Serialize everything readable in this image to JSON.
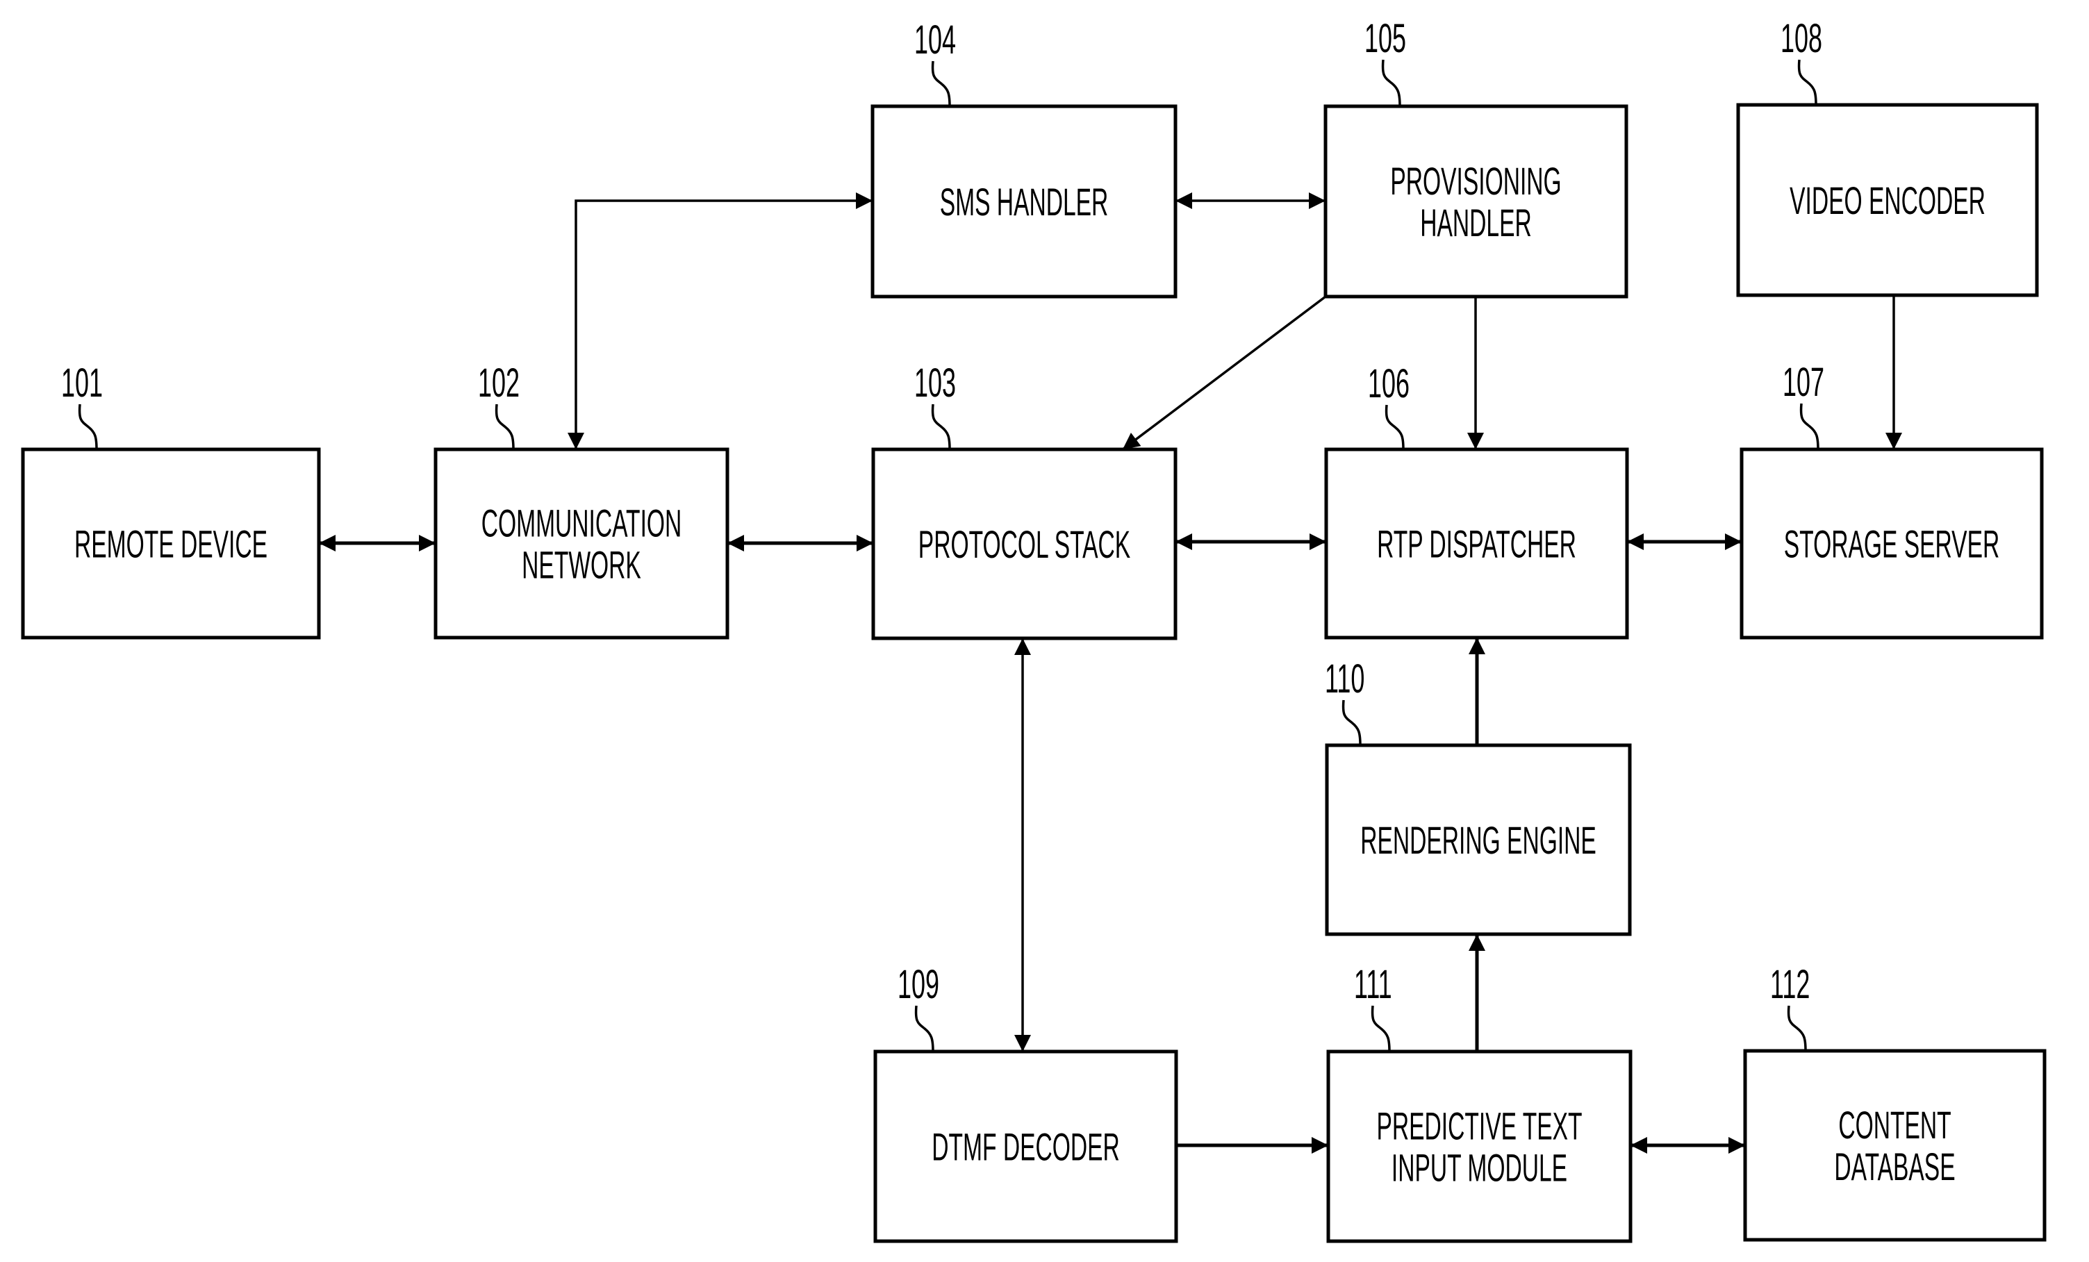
{
  "figure": {
    "type": "block-diagram",
    "colors": {
      "line": "#000000",
      "background": "#ffffff"
    }
  },
  "blocks": [
    {
      "id": "101",
      "ref": "101",
      "lines": [
        "REMOTE DEVICE"
      ]
    },
    {
      "id": "102",
      "ref": "102",
      "lines": [
        "COMMUNICATION",
        "NETWORK"
      ]
    },
    {
      "id": "103",
      "ref": "103",
      "lines": [
        "PROTOCOL STACK"
      ]
    },
    {
      "id": "104",
      "ref": "104",
      "lines": [
        "SMS HANDLER"
      ]
    },
    {
      "id": "105",
      "ref": "105",
      "lines": [
        "PROVISIONING",
        "HANDLER"
      ]
    },
    {
      "id": "106",
      "ref": "106",
      "lines": [
        "RTP DISPATCHER"
      ]
    },
    {
      "id": "107",
      "ref": "107",
      "lines": [
        "STORAGE SERVER"
      ]
    },
    {
      "id": "108",
      "ref": "108",
      "lines": [
        "VIDEO ENCODER"
      ]
    },
    {
      "id": "109",
      "ref": "109",
      "lines": [
        "DTMF DECODER"
      ]
    },
    {
      "id": "110",
      "ref": "110",
      "lines": [
        "RENDERING ENGINE"
      ]
    },
    {
      "id": "111",
      "ref": "111",
      "lines": [
        "PREDICTIVE TEXT",
        "INPUT MODULE"
      ]
    },
    {
      "id": "112",
      "ref": "112",
      "lines": [
        "CONTENT",
        "DATABASE"
      ]
    }
  ],
  "connections": [
    {
      "from": "101",
      "to": "102",
      "direction": "bidirectional"
    },
    {
      "from": "102",
      "to": "103",
      "direction": "bidirectional"
    },
    {
      "from": "102",
      "to": "104",
      "direction": "bidirectional"
    },
    {
      "from": "104",
      "to": "105",
      "direction": "bidirectional"
    },
    {
      "from": "105",
      "to": "103",
      "direction": "forward"
    },
    {
      "from": "105",
      "to": "106",
      "direction": "forward"
    },
    {
      "from": "103",
      "to": "106",
      "direction": "bidirectional"
    },
    {
      "from": "106",
      "to": "107",
      "direction": "bidirectional"
    },
    {
      "from": "108",
      "to": "107",
      "direction": "forward"
    },
    {
      "from": "103",
      "to": "109",
      "direction": "bidirectional"
    },
    {
      "from": "110",
      "to": "106",
      "direction": "forward"
    },
    {
      "from": "111",
      "to": "110",
      "direction": "forward"
    },
    {
      "from": "109",
      "to": "111",
      "direction": "forward"
    },
    {
      "from": "111",
      "to": "112",
      "direction": "bidirectional"
    }
  ]
}
